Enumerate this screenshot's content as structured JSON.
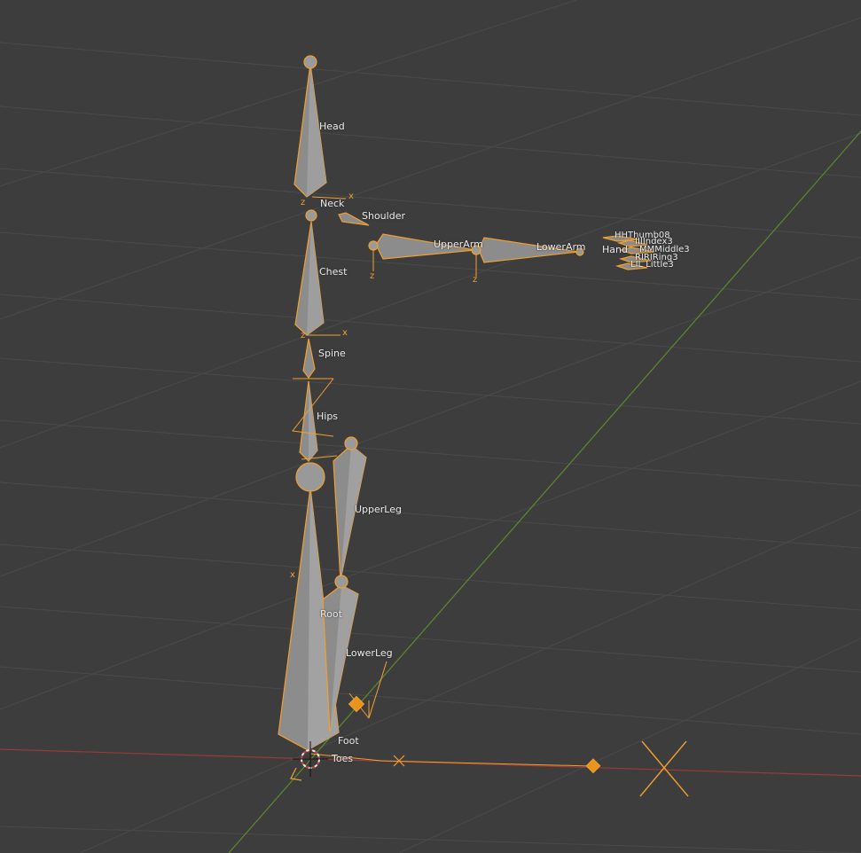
{
  "colors": {
    "background": "#3d3d3d",
    "grid": "#4a4a4a",
    "axis_x": "#9a3a3a",
    "axis_y": "#5a8a2e",
    "selection": "#f0a030",
    "bone_fill": "#8c8c8c",
    "label": "#e8e8e8"
  },
  "bones": {
    "head": "Head",
    "neck": "Neck",
    "shoulder": "Shoulder",
    "chest": "Chest",
    "upper_arm": "UpperArm",
    "lower_arm": "LowerArm",
    "hand": "Hand",
    "spine": "Spine",
    "hips": "Hips",
    "upper_leg": "UpperLeg",
    "root": "Root",
    "lower_leg": "LowerLeg",
    "foot": "Foot",
    "toes": "Toes"
  },
  "fingers": {
    "thumb": "HHThumb08",
    "index": "IIIIndex3",
    "middle": "MMMiddle3",
    "ring": "RIRIRing3",
    "little": "LIL Little3"
  },
  "axis_markers": {
    "x": "x",
    "z": "z"
  },
  "icons": [
    "bone-icon",
    "joint-icon",
    "empty-marker-icon",
    "cursor-icon",
    "camera-icon"
  ]
}
